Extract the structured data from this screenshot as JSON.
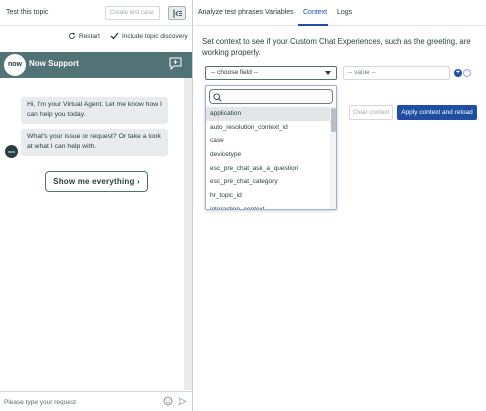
{
  "left": {
    "title": "Test this topic",
    "create_case_placeholder": "Create test case",
    "restart_label": "Restart",
    "include_label": "Include topic discovery",
    "chat": {
      "logo_text": "now",
      "title": "Now Support",
      "messages": [
        "Hi, I'm your Virtual Agent. Let me know how I can help you today.",
        "What's your issue or request? Or take a look at what I can help with."
      ],
      "avatar_text": "now",
      "show_button": "Show me everything ›",
      "input_placeholder": "Please type your request"
    }
  },
  "right": {
    "tabs": [
      {
        "label": "Analyze test phrases",
        "active": false
      },
      {
        "label": "Variables",
        "active": false
      },
      {
        "label": "Context",
        "active": true
      },
      {
        "label": "Logs",
        "active": false
      }
    ],
    "description": "Set context to see if your Custom Chat Experiences, such as the greeting, are working properly.",
    "field_select": "-- choose field --",
    "value_placeholder": "-- value --",
    "clear_button": "Clear context",
    "apply_button": "Apply context and reload",
    "dropdown": {
      "search_value": "",
      "options": [
        "application",
        "auto_resolution_context_id",
        "case",
        "devicetype",
        "esc_pre_chat_ask_a_question",
        "esc_pre_chat_category",
        "hr_topic_id",
        "interaction_context"
      ],
      "highlighted": "application"
    }
  },
  "colors": {
    "accent": "#1f4ea3",
    "chat_header": "#517375",
    "bubble": "#e8ecef",
    "text": "#293e40"
  }
}
